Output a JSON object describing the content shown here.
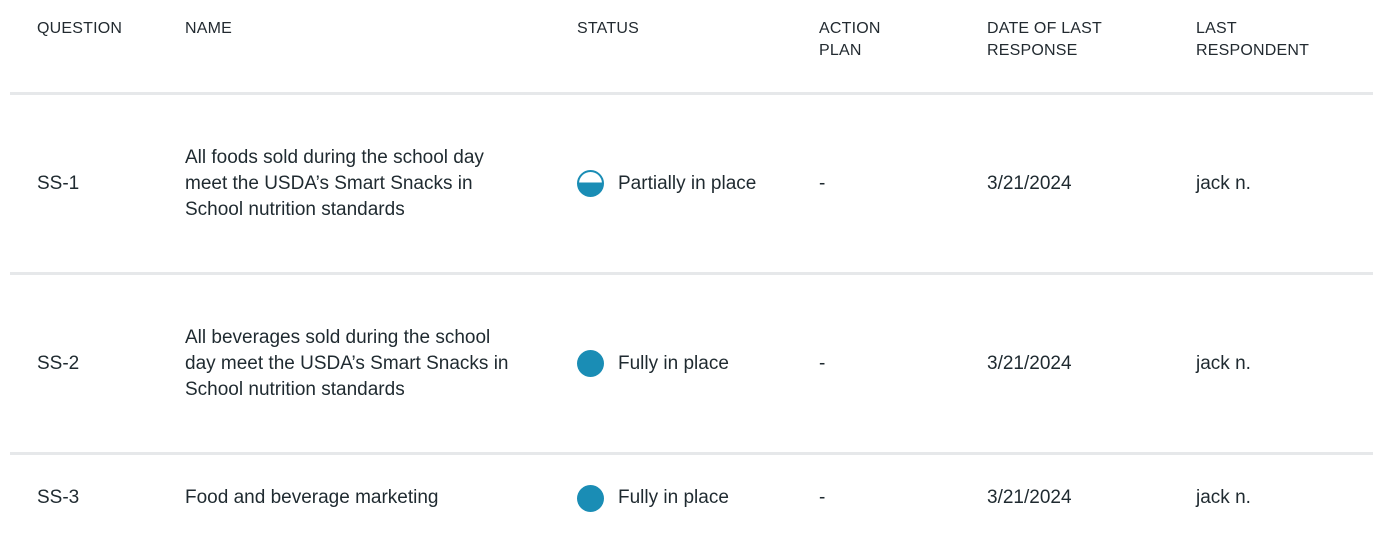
{
  "columns": {
    "question": "QUESTION",
    "name": "NAME",
    "status": "STATUS",
    "action_plan": "ACTION PLAN",
    "date_last_response": "DATE OF LAST RESPONSE",
    "last_respondent": "LAST RESPONDENT"
  },
  "rows": [
    {
      "question": "SS-1",
      "name": "All foods sold during the school day meet the USDA’s Smart Snacks in School nutrition standards",
      "status": "Partially in place",
      "status_icon": "half-filled-circle-icon",
      "action_plan": "-",
      "date": "3/21/2024",
      "respondent": "jack n."
    },
    {
      "question": "SS-2",
      "name": "All beverages sold during the school day meet the USDA’s Smart Snacks in School nutrition standards",
      "status": "Fully in place",
      "status_icon": "filled-circle-icon",
      "action_plan": "-",
      "date": "3/21/2024",
      "respondent": "jack n."
    },
    {
      "question": "SS-3",
      "name": "Food and beverage marketing",
      "status": "Fully in place",
      "status_icon": "filled-circle-icon",
      "action_plan": "-",
      "date": "3/21/2024",
      "respondent": "jack n."
    }
  ],
  "colors": {
    "status_accent": "#1a8db5",
    "divider": "#e6e8ea",
    "text": "#1f2a30"
  }
}
